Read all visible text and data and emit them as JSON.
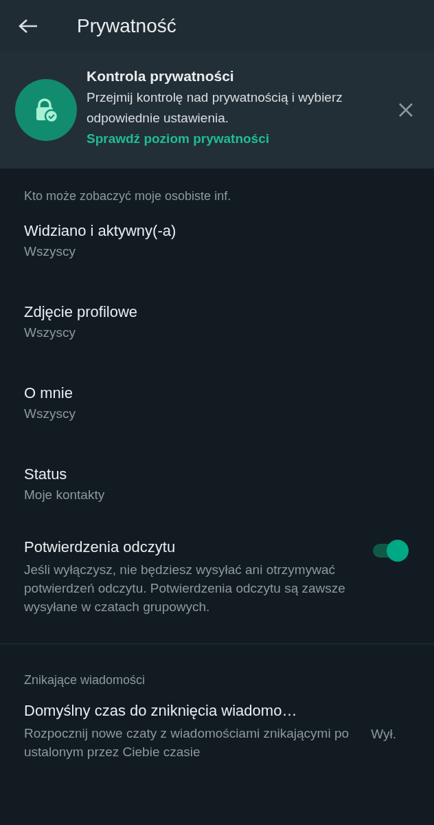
{
  "header": {
    "title": "Prywatność"
  },
  "banner": {
    "title": "Kontrola prywatności",
    "text": "Przejmij kontrolę nad prywatnością i wybierz odpowiednie ustawienia.",
    "link": "Sprawdź poziom prywatności"
  },
  "sections": [
    {
      "title": "Kto może zobaczyć moje osobiste inf.",
      "items": [
        {
          "kind": "setting",
          "title": "Widziano i aktywny(-a)",
          "value": "Wszyscy"
        },
        {
          "kind": "setting",
          "title": "Zdjęcie profilowe",
          "value": "Wszyscy"
        },
        {
          "kind": "setting",
          "title": "O mnie",
          "value": "Wszyscy"
        },
        {
          "kind": "setting",
          "title": "Status",
          "value": "Moje kontakty"
        },
        {
          "kind": "toggle",
          "title": "Potwierdzenia odczytu",
          "description": "Jeśli wyłączysz, nie będziesz wysyłać ani otrzymywać potwierdzeń odczytu. Potwierdzenia odczytu są zawsze wysyłane w czatach grupowych.",
          "on": true
        }
      ]
    },
    {
      "title": "Znikające wiadomości",
      "items": [
        {
          "kind": "detail",
          "title": "Domyślny czas do zniknięcia wiadomo…",
          "description": "Rozpocznij nowe czaty z wiadomościami znikającymi po ustalonym przez Ciebie czasie",
          "value": "Wył."
        }
      ]
    }
  ]
}
